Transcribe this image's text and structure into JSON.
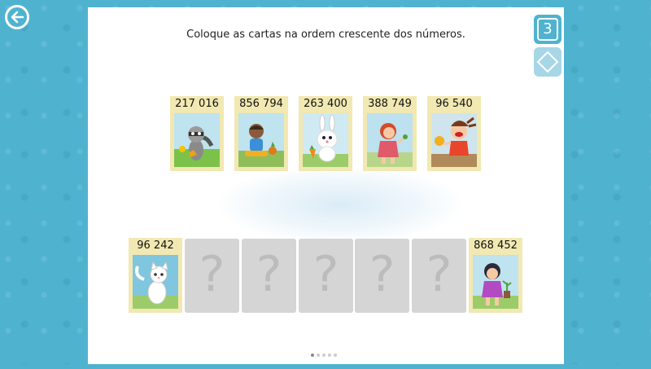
{
  "instruction": "Coloque as cartas na ordem crescente dos números.",
  "level": "3",
  "top_cards": [
    {
      "number": "217 016",
      "picture": "raccoon"
    },
    {
      "number": "856 794",
      "picture": "boy-planting"
    },
    {
      "number": "263 400",
      "picture": "white-rabbit"
    },
    {
      "number": "388 749",
      "picture": "red-haired-girl"
    },
    {
      "number": "96 540",
      "picture": "laughing-girl"
    }
  ],
  "placed_first": {
    "number": "96 242",
    "picture": "white-cat"
  },
  "placed_last": {
    "number": "868 452",
    "picture": "girl-with-plant"
  },
  "empty_slot_mark": "?",
  "pagination": {
    "total": 5,
    "current": 1
  },
  "colors": {
    "background": "#4fb3cf",
    "card": "#f1e8b2",
    "slot": "#d5d5d5"
  }
}
